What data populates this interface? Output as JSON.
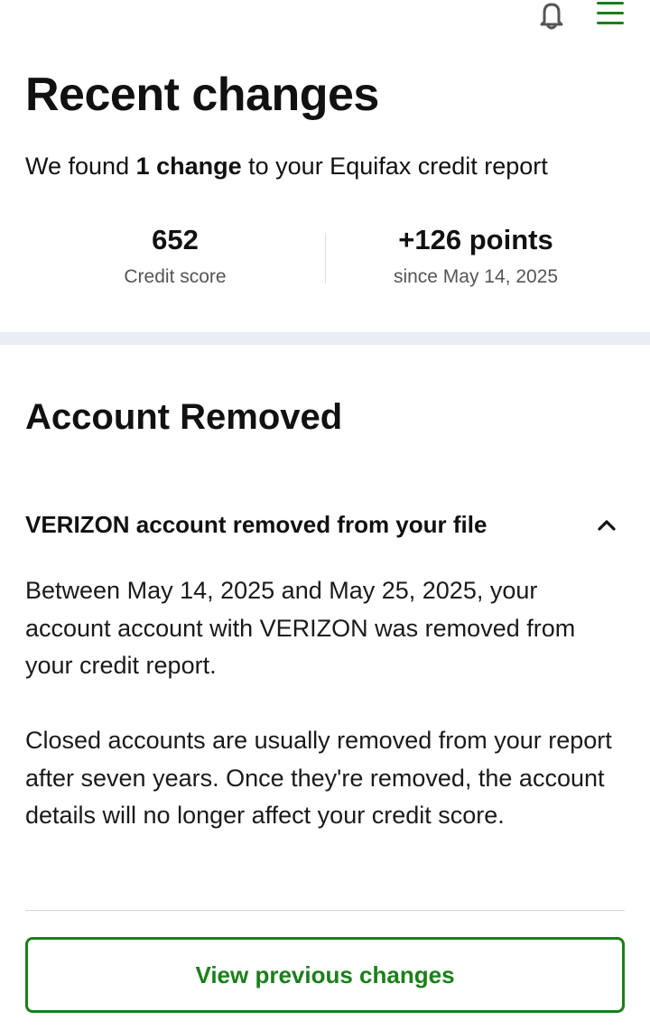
{
  "colors": {
    "accent": "#1b7f1b",
    "text": "#111111",
    "muted": "#555555",
    "band": "#e8eef3"
  },
  "icons": {
    "notifications": "bell-icon",
    "menu": "hamburger-menu-icon",
    "collapse": "chevron-up-icon"
  },
  "header": {
    "title": "Recent changes",
    "summary_prefix": "We found ",
    "summary_bold": "1 change",
    "summary_suffix": " to your Equifax credit report"
  },
  "stats": {
    "score_value": "652",
    "score_label": "Credit score",
    "change_value": "+126 points",
    "change_label": "since May 14, 2025"
  },
  "section": {
    "title": "Account Removed",
    "item_title": "VERIZON account removed from your file",
    "paragraph_1": "Between May 14, 2025 and May 25, 2025, your account account with VERIZON was removed from your credit report.",
    "paragraph_2": "Closed accounts are usually removed from your report after seven years. Once they're removed, the account details will no longer affect your credit score."
  },
  "actions": {
    "view_previous": "View previous changes"
  }
}
